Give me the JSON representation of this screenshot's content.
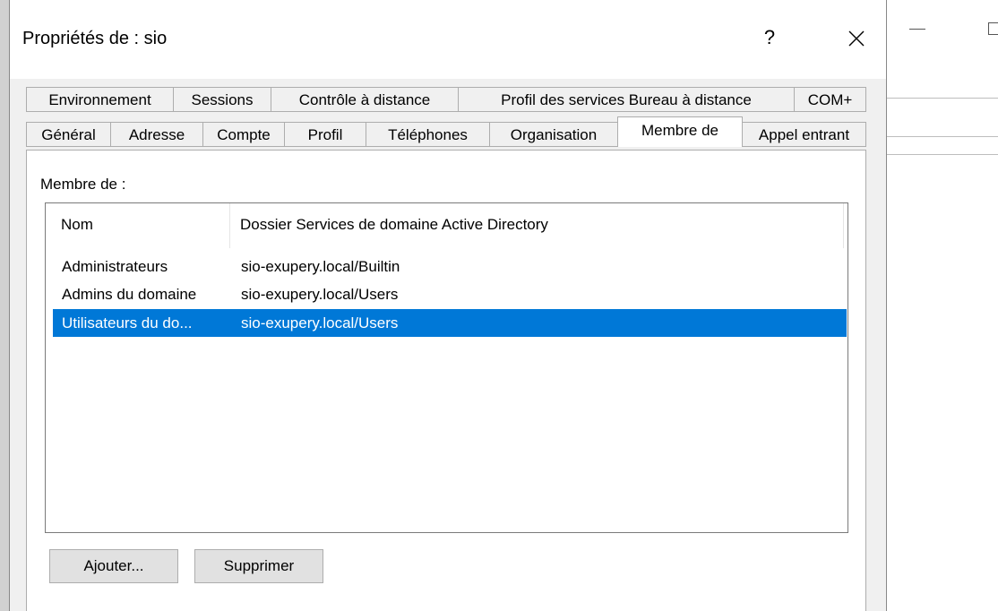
{
  "window": {
    "title": "Propriétés de : sio",
    "help_label": "?"
  },
  "tabs_row1": [
    {
      "label": "Environnement"
    },
    {
      "label": "Sessions"
    },
    {
      "label": "Contrôle à distance"
    },
    {
      "label": "Profil des services Bureau à distance"
    },
    {
      "label": "COM+"
    }
  ],
  "tabs_row2": [
    {
      "label": "Général"
    },
    {
      "label": "Adresse"
    },
    {
      "label": "Compte"
    },
    {
      "label": "Profil"
    },
    {
      "label": "Téléphones"
    },
    {
      "label": "Organisation"
    },
    {
      "label": "Membre de"
    },
    {
      "label": "Appel entrant"
    }
  ],
  "active_tab": "Membre de",
  "member_of": {
    "label": "Membre de :",
    "columns": [
      "Nom",
      "Dossier Services de domaine Active Directory"
    ],
    "rows": [
      {
        "name": "Administrateurs",
        "folder": "sio-exupery.local/Builtin",
        "selected": false
      },
      {
        "name": "Admins du domaine",
        "folder": "sio-exupery.local/Users",
        "selected": false
      },
      {
        "name": "Utilisateurs du do...",
        "folder": "sio-exupery.local/Users",
        "selected": true
      }
    ]
  },
  "buttons": {
    "add_label": "Ajouter...",
    "remove_label": "Supprimer"
  },
  "colors": {
    "selection": "#0078d7",
    "dialog_bg": "#f0f0f0"
  }
}
